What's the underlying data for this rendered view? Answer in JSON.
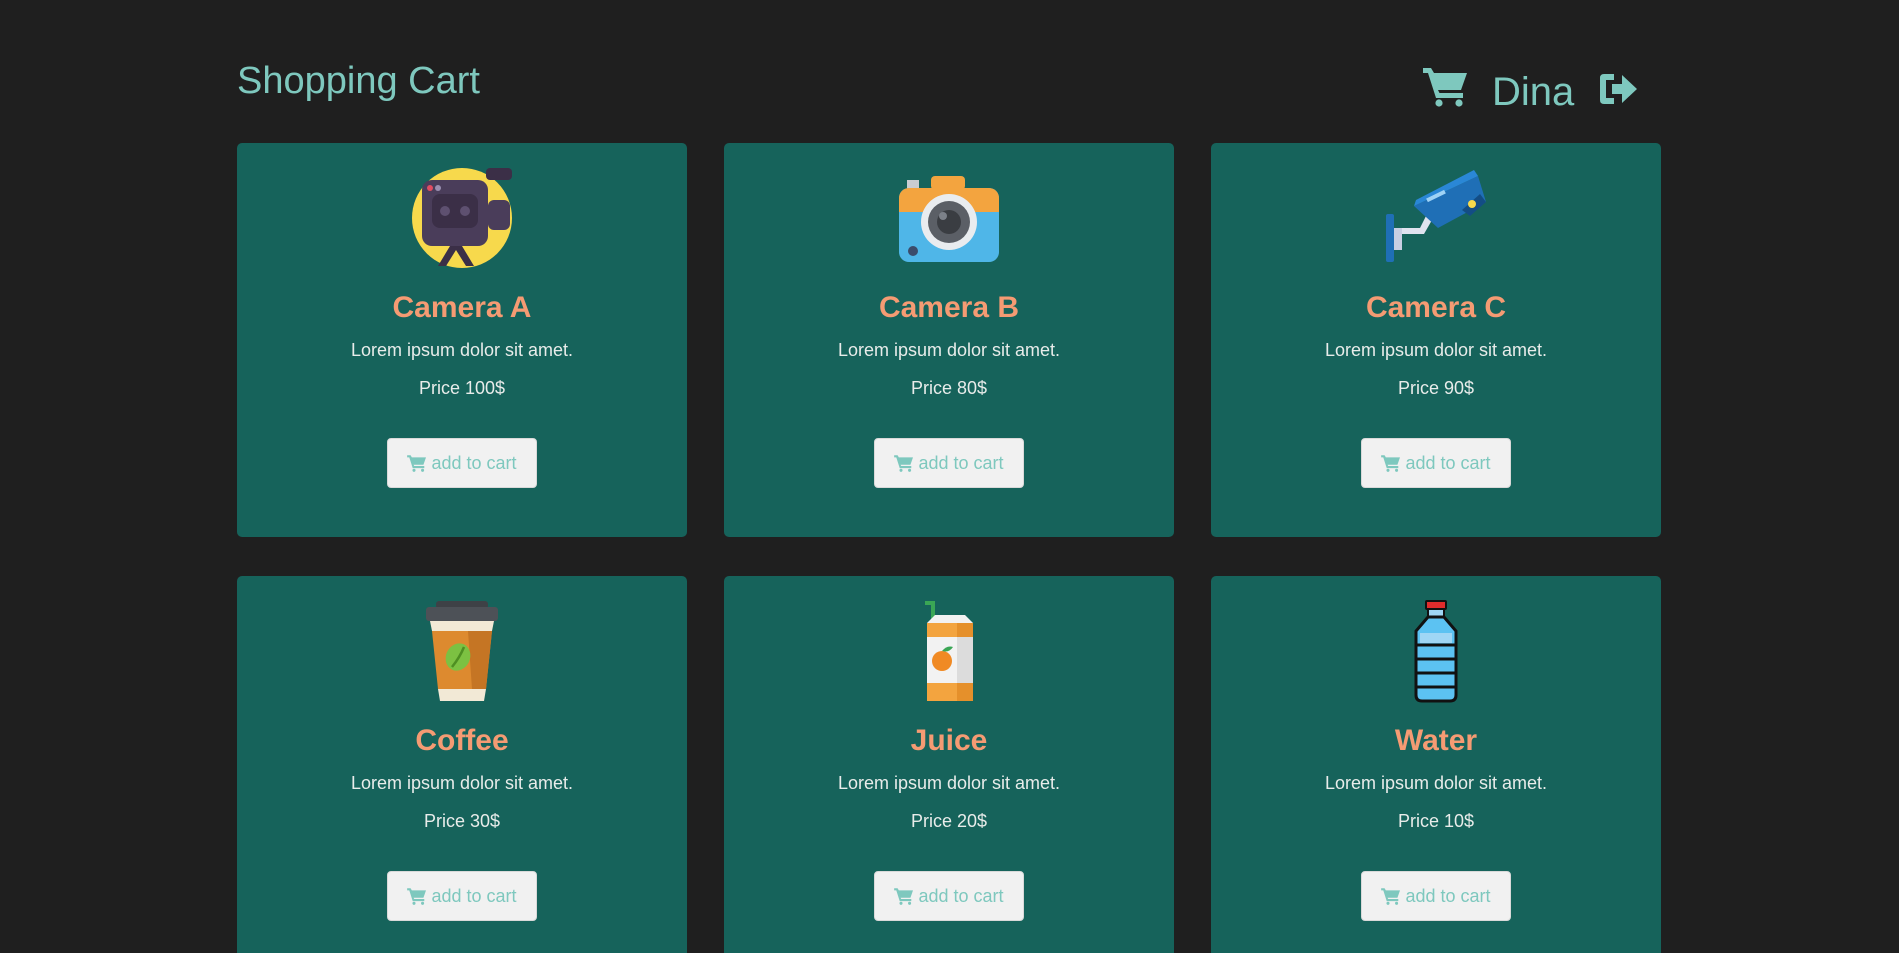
{
  "header": {
    "title": "Shopping Cart",
    "user_name": "Dina"
  },
  "colors": {
    "background": "#1f1f1f",
    "card": "#16635b",
    "accent": "#7ec8be",
    "title": "#f59b73"
  },
  "products": [
    {
      "name": "Camera A",
      "description": "Lorem ipsum dolor sit amet.",
      "price": "Price 100$",
      "button": "add to cart",
      "icon": "video-camera-icon"
    },
    {
      "name": "Camera B",
      "description": "Lorem ipsum dolor sit amet.",
      "price": "Price 80$",
      "button": "add to cart",
      "icon": "photo-camera-icon"
    },
    {
      "name": "Camera C",
      "description": "Lorem ipsum dolor sit amet.",
      "price": "Price 90$",
      "button": "add to cart",
      "icon": "security-camera-icon"
    },
    {
      "name": "Coffee",
      "description": "Lorem ipsum dolor sit amet.",
      "price": "Price 30$",
      "button": "add to cart",
      "icon": "coffee-cup-icon"
    },
    {
      "name": "Juice",
      "description": "Lorem ipsum dolor sit amet.",
      "price": "Price 20$",
      "button": "add to cart",
      "icon": "juice-box-icon"
    },
    {
      "name": "Water",
      "description": "Lorem ipsum dolor sit amet.",
      "price": "Price 10$",
      "button": "add to cart",
      "icon": "water-bottle-icon"
    }
  ]
}
